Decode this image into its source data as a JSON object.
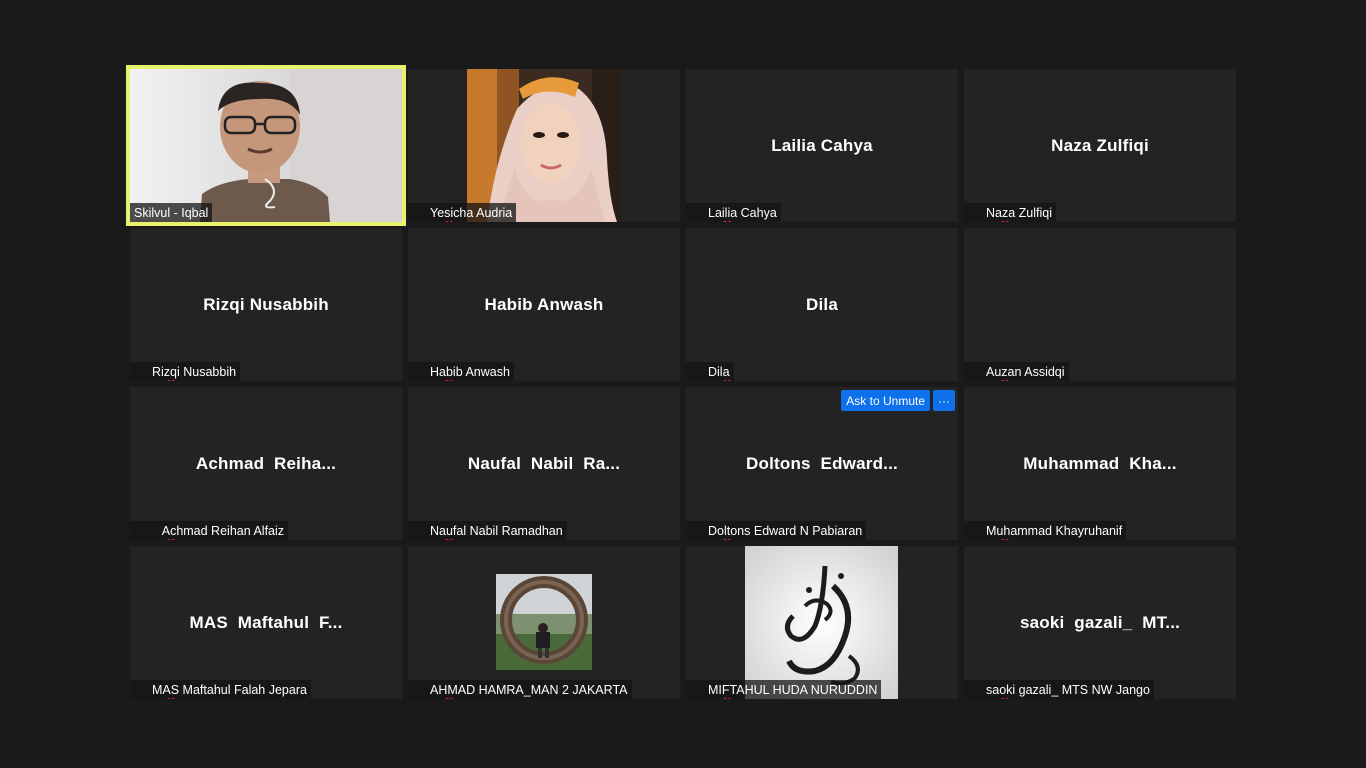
{
  "colors": {
    "background": "#1a1a1a",
    "tile": "#232323",
    "active_speaker": "#e6f36b",
    "mute_red": "#e0262b",
    "button_blue": "#0e71eb"
  },
  "tiles": [
    {
      "label": "Skilvul - Iqbal",
      "center": "",
      "muted": false,
      "video": "speaker"
    },
    {
      "label": "Yesicha Audria",
      "center": "",
      "muted": true,
      "video": "hijab"
    },
    {
      "label": "Lailia Cahya",
      "center": "Lailia Cahya",
      "muted": true
    },
    {
      "label": "Naza Zulfiqi",
      "center": "Naza Zulfiqi",
      "muted": true
    },
    {
      "label": "Rizqi Nusabbih",
      "center": "Rizqi Nusabbih",
      "muted": true
    },
    {
      "label": "Habib Anwash",
      "center": "Habib Anwash",
      "muted": true
    },
    {
      "label": "Dila",
      "center": "Dila",
      "muted": true
    },
    {
      "label": "Auzan Assidqi",
      "center": "",
      "muted": true
    },
    {
      "label": "   Achmad Reihan Alfaiz",
      "center": "Achmad  Reiha...",
      "muted": true
    },
    {
      "label": "Naufal Nabil Ramadhan",
      "center": "Naufal  Nabil  Ra...",
      "muted": true
    },
    {
      "label": "Doltons Edward N Pabiaran",
      "center": "Doltons  Edward...",
      "muted": true,
      "ask_unmute": "Ask to Unmute",
      "more": "···"
    },
    {
      "label": "Muhammad Khayruhanif",
      "center": "Muhammad  Kha...",
      "muted": true
    },
    {
      "label": "MAS Maftahul Falah Jepara",
      "center": "MAS  Maftahul  F...",
      "muted": true
    },
    {
      "label": "AHMAD HAMRA_MAN 2 JAKARTA",
      "center": "",
      "muted": true,
      "video": "ring"
    },
    {
      "label": "MIFTAHUL HUDA NURUDDIN",
      "center": "",
      "muted": true,
      "video": "calligraphy"
    },
    {
      "label": "saoki gazali_ MTS NW Jango",
      "center": "saoki  gazali_  MT...",
      "muted": true
    }
  ]
}
